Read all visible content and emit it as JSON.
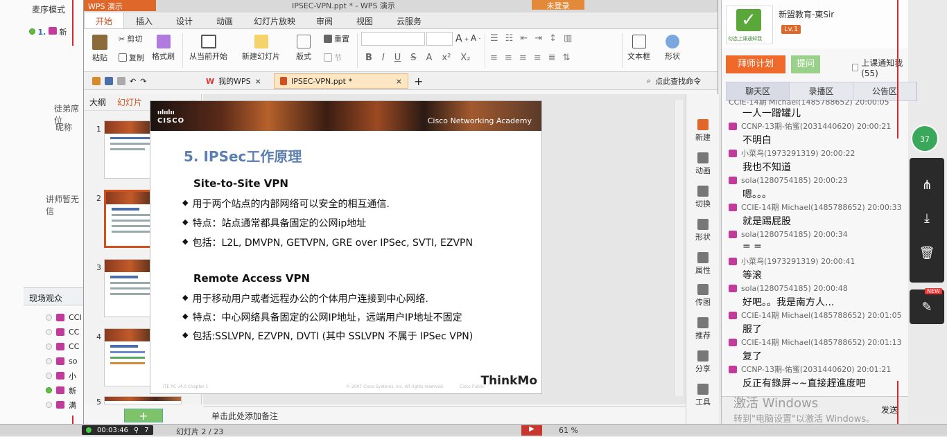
{
  "left_panel": {
    "mode": "麦序模式",
    "row_number": "1.",
    "row_name": "新",
    "label_queue": "徒弟席位",
    "label_nickname": "昵称",
    "label_no_teacher": "讲师暂无信",
    "audience_title": "现场观众",
    "audience": [
      {
        "name": "CCI",
        "online": false
      },
      {
        "name": "CC",
        "online": false
      },
      {
        "name": "CC",
        "online": false
      },
      {
        "name": "so",
        "online": false
      },
      {
        "name": "小",
        "online": false
      },
      {
        "name": "新",
        "online": true
      },
      {
        "name": "满",
        "online": false
      }
    ]
  },
  "wps": {
    "app_name": "WPS 演示",
    "window_title": "IPSEC-VPN.ppt * - WPS 演示",
    "login_label": "未登录",
    "tabs": [
      "开始",
      "插入",
      "设计",
      "动画",
      "幻灯片放映",
      "审阅",
      "视图",
      "云服务"
    ],
    "ribbon": {
      "paste": "粘贴",
      "cut": "剪切",
      "copy": "复制",
      "format_painter": "格式刷",
      "from_current": "从当前开始",
      "new_slide": "新建幻灯片",
      "layout": "版式",
      "reset": "重置",
      "section": "节",
      "textbox": "文本框",
      "shape": "形状"
    },
    "doc_tabs": [
      {
        "label": "我的WPS",
        "active": false
      },
      {
        "label": "IPSEC-VPN.ppt *",
        "active": true
      }
    ],
    "search_label": "点此查找命令",
    "outline_tabs": [
      "大纲",
      "幻灯片"
    ],
    "thumb_numbers": [
      "1",
      "2",
      "3",
      "4",
      "5"
    ],
    "notes_placeholder": "单击此处添加备注",
    "right_tools": [
      "新建",
      "动画",
      "切换",
      "形状",
      "属性",
      "传图",
      "推荐",
      "分享",
      "工具"
    ]
  },
  "slide": {
    "brand": "CISCO",
    "academy": "Cisco Networking Academy",
    "title": "5. IPSec工作原理",
    "section1": {
      "heading": "Site-to-Site VPN",
      "bullets": [
        "用于两个站点的内部网络可以安全的相互通信.",
        "特点：站点通常都具备固定的公网ip地址",
        "包括：L2L, DMVPN, GETVPN, GRE over IPSec, SVTI, EZVPN"
      ]
    },
    "section2": {
      "heading": "Remote Access VPN",
      "bullets": [
        "用于移动用户或者远程办公的个体用户连接到中心网络.",
        "特点：中心网络具备固定的公网IP地址，远端用户IP地址不固定",
        "包括:SSLVPN, EZVPN, DVTI (其中 SSLVPN 不属于 IPSec VPN)"
      ]
    },
    "footer_left": "ITE PC v4.0 Chapter 1",
    "footer_mid": "© 2007 Cisco Systems, Inc. All rights reserved.",
    "footer_right": "Cisco Public",
    "logo_text": "ThinkMo"
  },
  "statusbar": {
    "timer": "00:03:46",
    "viewers": "7",
    "slide_info": "幻灯片 2 / 23",
    "zoom": "61 %"
  },
  "chat": {
    "org_name": "新盟教育-東Sir",
    "level": "Lv.1",
    "logo_caption": "勿选上课通知我",
    "plan_button": "拜师计划",
    "ask_button": "提问",
    "notify_label": "上课通知我(55)",
    "tabs": [
      "聊天区",
      "录播区",
      "公告区"
    ],
    "messages": [
      {
        "user": "CCIE-14期 Michael(1485788652) 20:00:05",
        "text": "一人一蹭罐儿"
      },
      {
        "user": "CCNP-13期-佑蜜(2031440620) 20:00:21",
        "text": "不明白"
      },
      {
        "user": "小菜鸟(1973291319) 20:00:22",
        "text": "我也不知道"
      },
      {
        "user": "sola(1280754185) 20:00:23",
        "text": "嗯。。。"
      },
      {
        "user": "CCIE-14期 Michael(1485788652) 20:00:33",
        "text": "就是踢屁股"
      },
      {
        "user": "sola(1280754185) 20:00:34",
        "text": "= ="
      },
      {
        "user": "小菜鸟(1973291319) 20:00:41",
        "text": "等滚"
      },
      {
        "user": "sola(1280754185) 20:00:48",
        "text": "好吧。。我是南方人..."
      },
      {
        "user": "CCIE-14期 Michael(1485788652) 20:01:05",
        "text": "服了"
      },
      {
        "user": "CCIE-14期 Michael(1485788652) 20:01:13",
        "text": "复了"
      },
      {
        "user": "CCNP-13期-佑蜜(2031440620) 20:01:21",
        "text": "反正有錄屏~~直接趕進度吧"
      }
    ],
    "send_label": "发送",
    "watermark_title": "激活 Windows",
    "watermark_sub": "转到\"电脑设置\"以激活 Windows。"
  },
  "float": {
    "badge_count": "37",
    "new_badge": "NEW"
  }
}
